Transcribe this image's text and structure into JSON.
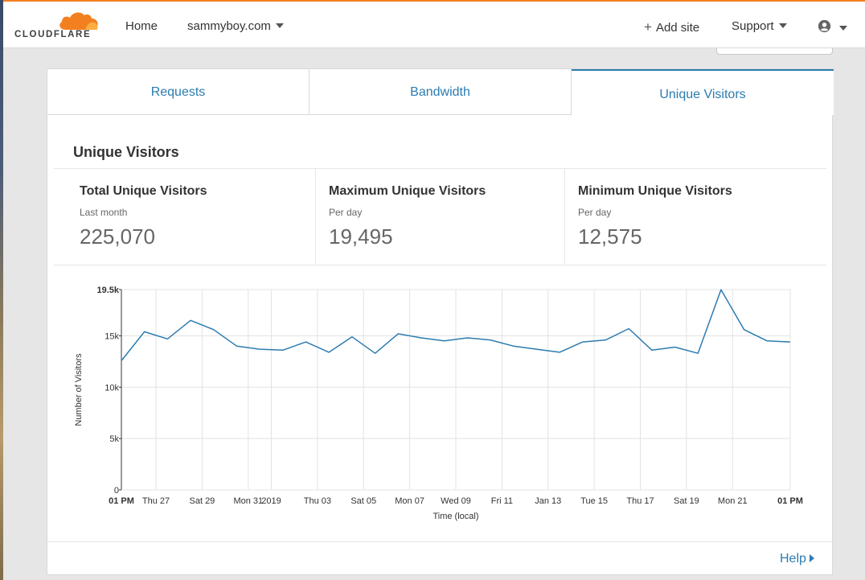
{
  "header": {
    "logo_text": "CLOUDFLARE",
    "nav": {
      "home": "Home",
      "domain": "sammyboy.com",
      "add_site": "Add site",
      "support": "Support"
    }
  },
  "tabs": [
    {
      "label": "Requests",
      "active": false
    },
    {
      "label": "Bandwidth",
      "active": false
    },
    {
      "label": "Unique Visitors",
      "active": true
    }
  ],
  "section_title": "Unique Visitors",
  "stats": [
    {
      "label": "Total Unique Visitors",
      "sub": "Last month",
      "value": "225,070"
    },
    {
      "label": "Maximum Unique Visitors",
      "sub": "Per day",
      "value": "19,495"
    },
    {
      "label": "Minimum Unique Visitors",
      "sub": "Per day",
      "value": "12,575"
    }
  ],
  "footer": {
    "help": "Help"
  },
  "colors": {
    "accent": "#2c7cb0",
    "brand": "#f38020",
    "line": "#2c7cb0"
  },
  "chart_data": {
    "type": "line",
    "title": "",
    "xlabel": "Time (local)",
    "ylabel": "Number of Visitors",
    "ylim": [
      0,
      19500
    ],
    "ytick_labels": [
      "0",
      "5k",
      "10k",
      "15k",
      "19.5k"
    ],
    "ytick_values": [
      0,
      5000,
      10000,
      15000,
      19500
    ],
    "xtick_labels": [
      "01 PM",
      "Thu 27",
      "Sat 29",
      "Mon 31",
      "2019",
      "Thu 03",
      "Sat 05",
      "Mon 07",
      "Wed 09",
      "Fri 11",
      "Jan 13",
      "Tue 15",
      "Thu 17",
      "Sat 19",
      "Mon 21",
      "01 PM"
    ],
    "xtick_positions": [
      0,
      1.5,
      3.5,
      5.5,
      6.5,
      8.5,
      10.5,
      12.5,
      14.5,
      16.5,
      18.5,
      20.5,
      22.5,
      24.5,
      26.5,
      29
    ],
    "xtick_bold": [
      true,
      false,
      false,
      false,
      false,
      false,
      false,
      false,
      false,
      false,
      false,
      false,
      false,
      false,
      false,
      true
    ],
    "grid": true,
    "series": [
      {
        "values": [
          12575,
          15400,
          14700,
          16500,
          15600,
          14000,
          13700,
          13600,
          14400,
          13400,
          14900,
          13300,
          15200,
          14800,
          14500,
          14800,
          14600,
          14000,
          13700,
          13400,
          14400,
          14600,
          15700,
          13600,
          13900,
          13300,
          19495,
          15600,
          14500,
          14400
        ]
      }
    ]
  }
}
